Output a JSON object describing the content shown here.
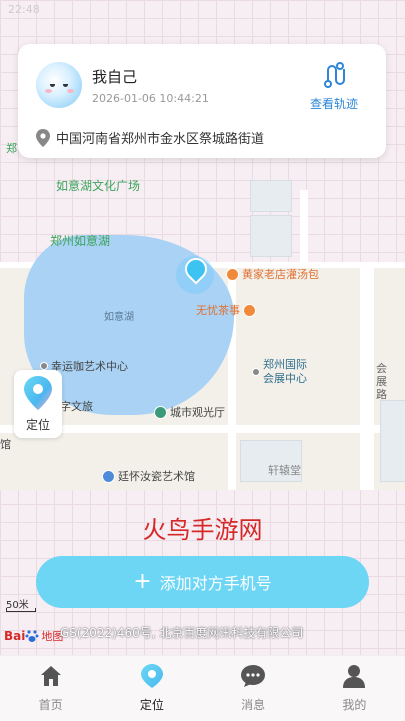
{
  "status_bar": {
    "time": "22:48"
  },
  "card": {
    "name": "我自己",
    "time": "2026-01-06 10:44:21",
    "track_label": "查看轨迹",
    "address": "中国河南省郑州市金水区祭城路街道"
  },
  "map": {
    "labels": {
      "culture_square": "如意湖文化广场",
      "ruyi_lake_name": "郑州如意湖",
      "lake": "如意湖",
      "road_east": "会展路",
      "edge_left": "郑",
      "pavilion": "轩辕堂",
      "partial_left": "馆"
    },
    "pois": {
      "huangjia": "黄家老店灌汤包",
      "wuyou": "无忧茶事",
      "xingyun": "幸运咖艺术中心",
      "exhibition_1": "郑州国际",
      "exhibition_2": "会展中心",
      "city_hall": "城市观光厅",
      "wenlv": "字文旅",
      "tinghuai": "廷怀汝瓷艺术馆"
    },
    "locate_label": "定位",
    "scale": "50米",
    "baidu_logo": {
      "bai": "Bai",
      "du": "du",
      "map": "地图"
    },
    "copyright": "GS(2022)460号, 北京百度网讯科技有限公司"
  },
  "watermark": "火鸟手游网",
  "add_button": {
    "plus": "+",
    "label": "添加对方手机号"
  },
  "tabs": [
    {
      "label": "首页",
      "icon": "home-icon"
    },
    {
      "label": "定位",
      "icon": "location-icon"
    },
    {
      "label": "消息",
      "icon": "message-icon"
    },
    {
      "label": "我的",
      "icon": "profile-icon"
    }
  ],
  "colors": {
    "accent": "#6dd6f5",
    "link": "#2d86d8",
    "watermark": "#d62828"
  }
}
